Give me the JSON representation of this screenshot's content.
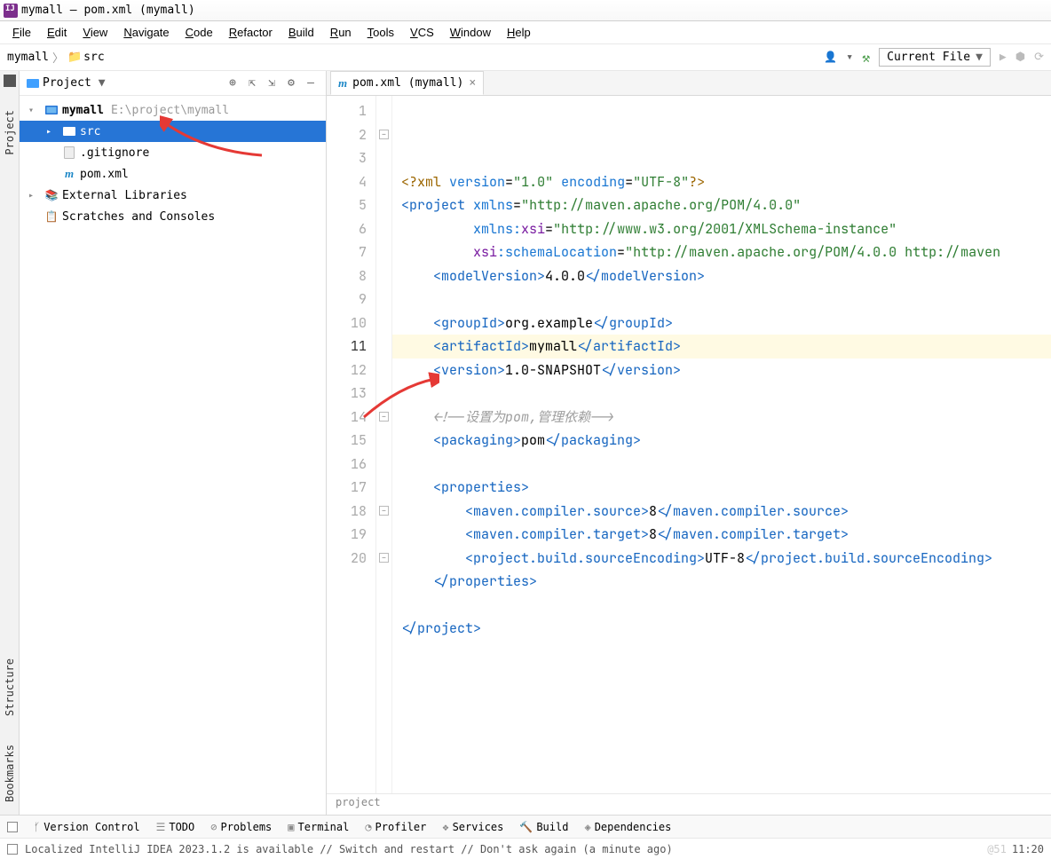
{
  "titlebar": "mymall – pom.xml (mymall)",
  "menu": [
    "File",
    "Edit",
    "View",
    "Navigate",
    "Code",
    "Refactor",
    "Build",
    "Run",
    "Tools",
    "VCS",
    "Window",
    "Help"
  ],
  "breadcrumbs": [
    "mymall",
    "src"
  ],
  "run_config": "Current File",
  "project_panel_title": "Project",
  "tree": {
    "root": {
      "name": "mymall",
      "path": "E:\\project\\mymall"
    },
    "src": "src",
    "gitignore": ".gitignore",
    "pom": "pom.xml",
    "ext_lib": "External Libraries",
    "scratches": "Scratches and Consoles"
  },
  "editor_tab": "pom.xml (mymall)",
  "line_count": 20,
  "current_line": 11,
  "code_lines": [
    {
      "n": 1,
      "html": "<span class='t-pi'>&lt;?xml</span> <span class='t-attr'>version</span>=<span class='t-str'>\"1.0\"</span> <span class='t-attr'>encoding</span>=<span class='t-str'>\"UTF-8\"</span><span class='t-pi'>?&gt;</span>"
    },
    {
      "n": 2,
      "html": "<span class='t-tag'>&lt;project</span> <span class='t-attr'>xmlns</span>=<span class='t-str'>\"http://maven.apache.org/POM/4.0.0\"</span>"
    },
    {
      "n": 3,
      "html": "         <span class='t-attr'>xmlns:</span><span class='t-ns'>xsi</span>=<span class='t-str'>\"http://www.w3.org/2001/XMLSchema-instance\"</span>"
    },
    {
      "n": 4,
      "html": "         <span class='t-ns'>xsi</span><span class='t-attr'>:schemaLocation</span>=<span class='t-str'>\"http://maven.apache.org/POM/4.0.0 http://maven</span>"
    },
    {
      "n": 5,
      "html": "    <span class='t-tag'>&lt;modelVersion&gt;</span>4.0.0<span class='t-tag'>&lt;/modelVersion&gt;</span>"
    },
    {
      "n": 6,
      "html": ""
    },
    {
      "n": 7,
      "html": "    <span class='t-tag'>&lt;groupId&gt;</span>org.example<span class='t-tag'>&lt;/groupId&gt;</span>"
    },
    {
      "n": 8,
      "html": "    <span class='t-tag'>&lt;artifactId&gt;</span>mymall<span class='t-tag'>&lt;/artifactId&gt;</span>"
    },
    {
      "n": 9,
      "html": "    <span class='t-tag'>&lt;version&gt;</span>1.0-SNAPSHOT<span class='t-tag'>&lt;/version&gt;</span>"
    },
    {
      "n": 10,
      "html": ""
    },
    {
      "n": 11,
      "html": "    <span class='t-cmt'>&lt;!--设置为pom,管理依赖--&gt;</span>"
    },
    {
      "n": 12,
      "html": "    <span class='t-tag'>&lt;packaging&gt;</span>pom<span class='t-tag'>&lt;/packaging&gt;</span>"
    },
    {
      "n": 13,
      "html": ""
    },
    {
      "n": 14,
      "html": "    <span class='t-tag'>&lt;properties&gt;</span>"
    },
    {
      "n": 15,
      "html": "        <span class='t-tag'>&lt;maven.compiler.source&gt;</span>8<span class='t-tag'>&lt;/maven.compiler.source&gt;</span>"
    },
    {
      "n": 16,
      "html": "        <span class='t-tag'>&lt;maven.compiler.target&gt;</span>8<span class='t-tag'>&lt;/maven.compiler.target&gt;</span>"
    },
    {
      "n": 17,
      "html": "        <span class='t-tag'>&lt;project.build.sourceEncoding&gt;</span>UTF-8<span class='t-tag'>&lt;/project.build.sourceEncoding&gt;</span>"
    },
    {
      "n": 18,
      "html": "    <span class='t-tag'>&lt;/properties&gt;</span>"
    },
    {
      "n": 19,
      "html": ""
    },
    {
      "n": 20,
      "html": "<span class='t-tag'>&lt;/project&gt;</span>"
    }
  ],
  "editor_breadcrumb": "project",
  "bottom_tabs": [
    "Version Control",
    "TODO",
    "Problems",
    "Terminal",
    "Profiler",
    "Services",
    "Build",
    "Dependencies"
  ],
  "status_msg": "Localized IntelliJ IDEA 2023.1.2 is available // Switch and restart // Don't ask again (a minute ago)",
  "status_right": "11:20",
  "watermark": "@51",
  "left_tabs": {
    "project": "Project",
    "structure": "Structure",
    "bookmarks": "Bookmarks"
  }
}
